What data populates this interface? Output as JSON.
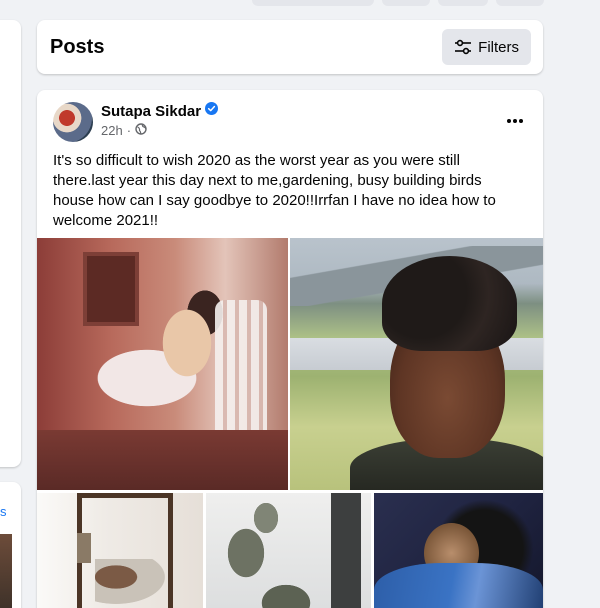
{
  "left_column": {
    "link_fragment": "s"
  },
  "posts_header": {
    "title": "Posts",
    "filters_label": "Filters",
    "filters_icon": "sliders-icon"
  },
  "post": {
    "author": "Sutapa Sikdar",
    "verified_icon": "verified-badge-icon",
    "time": "22h",
    "separator": "·",
    "audience_icon": "globe-icon",
    "more_icon": "more-horizontal-icon",
    "text": "It's so difficult to wish 2020 as the worst year as you were still there.last year this day next to me,gardening, busy building birds house how can I say goodbye to 2020!!Irrfan I have no idea how to welcome 2021!!",
    "photos": [
      {
        "name": "photo-reading-on-chair"
      },
      {
        "name": "photo-portrait-outdoors"
      },
      {
        "name": "photo-bedroom"
      },
      {
        "name": "photo-window-tree"
      },
      {
        "name": "photo-embrace"
      }
    ]
  },
  "colors": {
    "background": "#f0f2f5",
    "card": "#ffffff",
    "button_gray": "#e4e6eb",
    "verified_blue": "#1877f2",
    "secondary_text": "#65676b"
  }
}
